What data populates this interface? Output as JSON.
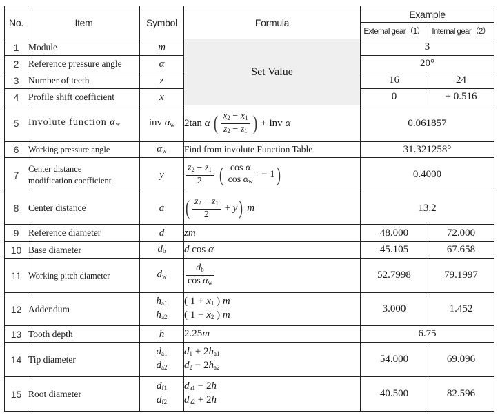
{
  "header": {
    "no": "No.",
    "item": "Item",
    "symbol": "Symbol",
    "formula": "Formula",
    "example": "Example",
    "external_gear": "External gear（1）",
    "internal_gear": "Internal gear（2）"
  },
  "set_value_label": "Set Value",
  "rows": [
    {
      "no": "1",
      "item": "Module",
      "symbol": "m",
      "example_merged": "3"
    },
    {
      "no": "2",
      "item": "Reference pressure angle",
      "symbol": "α",
      "example_merged": "20°"
    },
    {
      "no": "3",
      "item": "Number of teeth",
      "symbol": "z",
      "external": "16",
      "internal": "24"
    },
    {
      "no": "4",
      "item": "Profile shift coefficient",
      "symbol": "x",
      "external": "0",
      "internal": "+ 0.516"
    },
    {
      "no": "5",
      "item": "Involute function αw",
      "symbol": "inv αw",
      "formula": "2tan α ((x2 − x1)/(z2 − z1)) + inv α",
      "example_merged": "0.061857"
    },
    {
      "no": "6",
      "item": "Working pressure angle",
      "symbol": "αw",
      "formula": "Find from involute Function Table",
      "example_merged": "31.321258°"
    },
    {
      "no": "7",
      "item_line1": "Center distance",
      "item_line2": "modification coefficient",
      "symbol": "y",
      "formula": "(z2 − z1)/2 (cos α / cos αw − 1)",
      "example_merged": "0.4000"
    },
    {
      "no": "8",
      "item": "Center distance",
      "symbol": "a",
      "formula": "((z2 − z1)/2 + y) m",
      "example_merged": "13.2"
    },
    {
      "no": "9",
      "item": "Reference diameter",
      "symbol": "d",
      "formula": "zm",
      "external": "48.000",
      "internal": "72.000"
    },
    {
      "no": "10",
      "item": "Base diameter",
      "symbol": "db",
      "formula": "d cos α",
      "external": "45.105",
      "internal": "67.658"
    },
    {
      "no": "11",
      "item": "Working pitch diameter",
      "symbol": "dw",
      "formula": "db / cos αw",
      "external": "52.7998",
      "internal": "79.1997"
    },
    {
      "no": "12",
      "item": "Addendum",
      "symbol_line1": "ha1",
      "symbol_line2": "ha2",
      "formula_line1": "( 1 + x1 ) m",
      "formula_line2": "( 1 − x2 ) m",
      "external": "3.000",
      "internal": "1.452"
    },
    {
      "no": "13",
      "item": "Tooth depth",
      "symbol": "h",
      "formula": "2.25m",
      "example_merged": "6.75"
    },
    {
      "no": "14",
      "item": "Tip diameter",
      "symbol_line1": "da1",
      "symbol_line2": "da2",
      "formula_line1": "d1 + 2ha1",
      "formula_line2": "d2 − 2ha2",
      "external": "54.000",
      "internal": "69.096"
    },
    {
      "no": "15",
      "item": "Root diameter",
      "symbol_line1": "df1",
      "symbol_line2": "df2",
      "formula_line1": "da1 − 2h",
      "formula_line2": "da2 + 2h",
      "external": "40.500",
      "internal": "82.596"
    }
  ],
  "math": {
    "inv": "inv",
    "tan2": "2tan",
    "cos": "cos",
    "find_text": "Find from involute Function Table",
    "minus1": "− 1",
    "plus_y": "+ y",
    "plus_inv": "+ inv"
  }
}
